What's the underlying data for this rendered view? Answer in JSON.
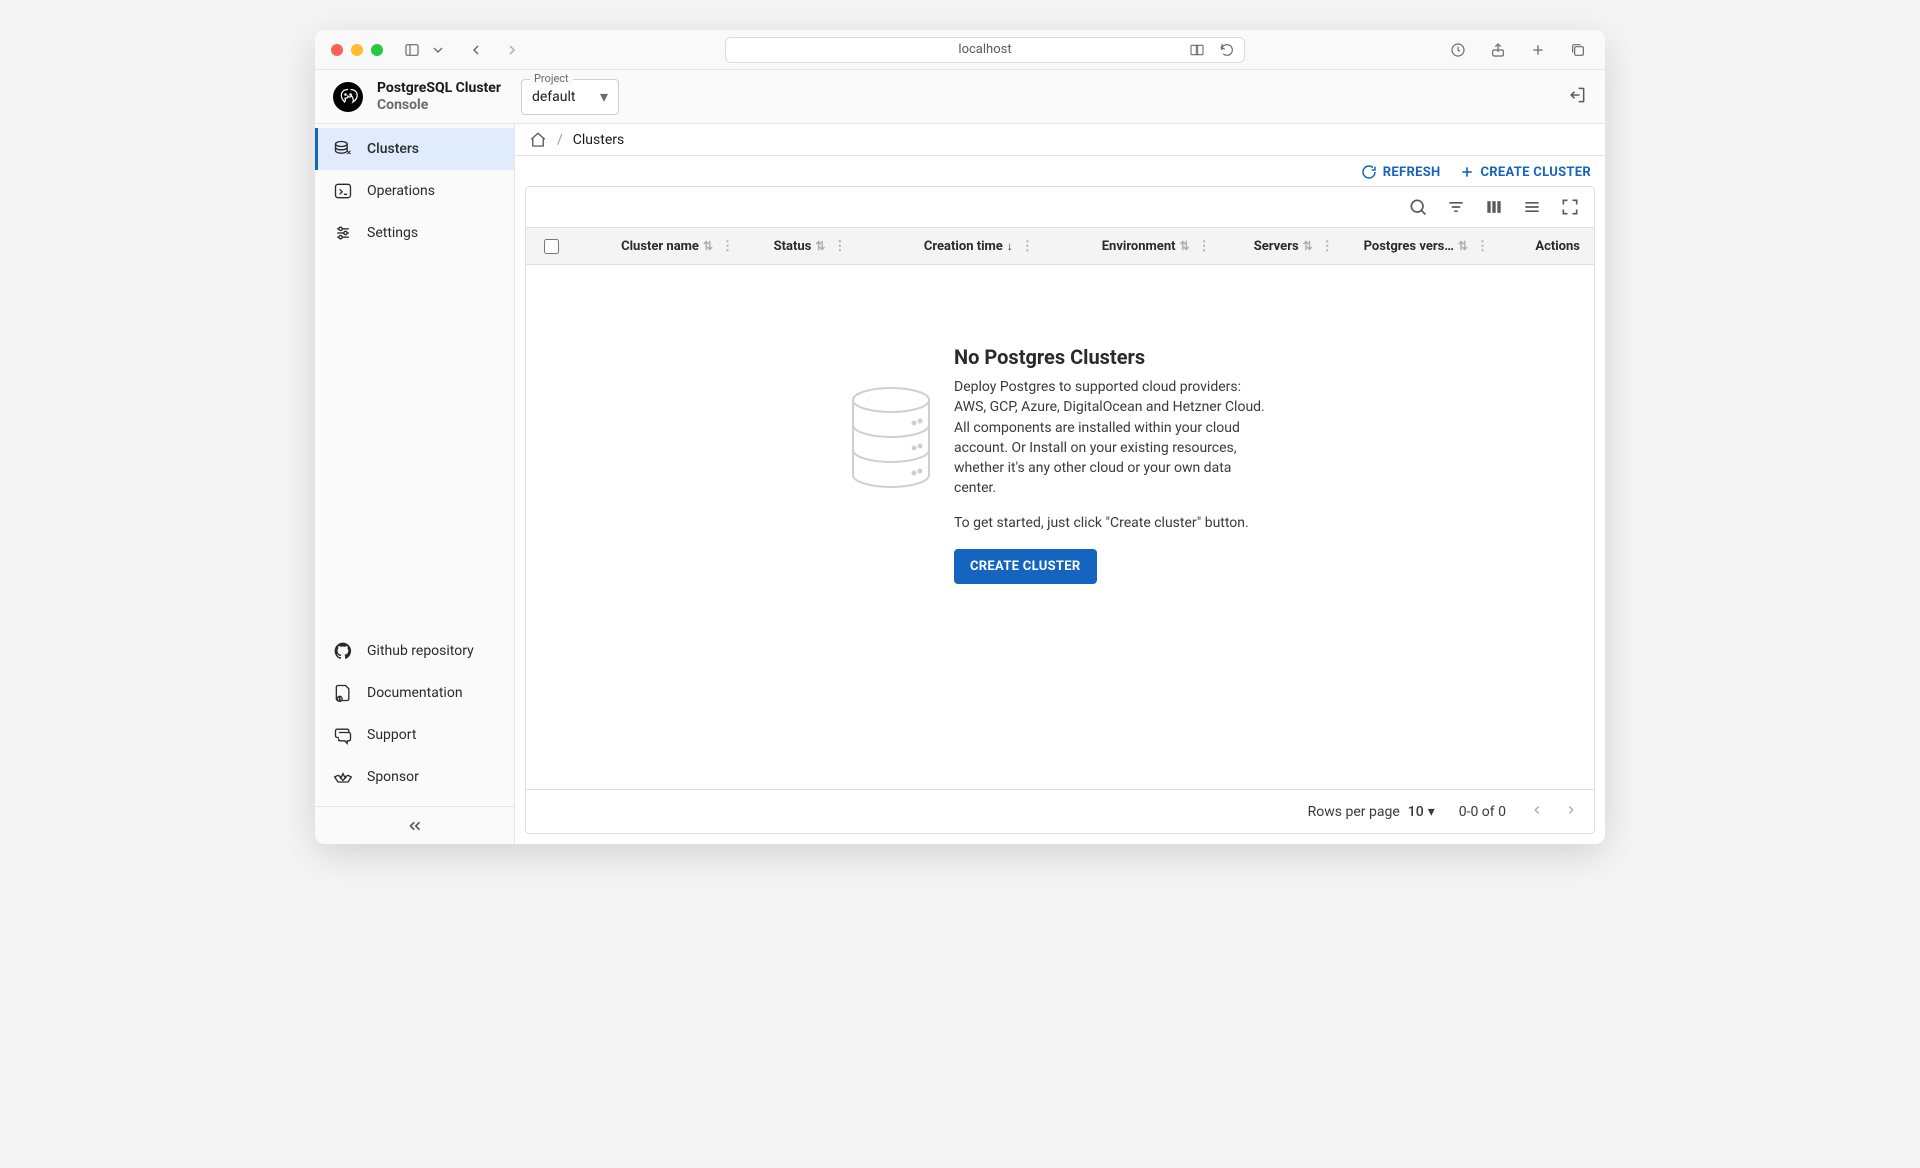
{
  "browser": {
    "address": "localhost"
  },
  "app": {
    "title_line1": "PostgreSQL Cluster",
    "title_line2": "Console",
    "project_label": "Project",
    "project_value": "default"
  },
  "sidebar": {
    "nav": [
      {
        "label": "Clusters"
      },
      {
        "label": "Operations"
      },
      {
        "label": "Settings"
      }
    ],
    "footer": [
      {
        "label": "Github repository"
      },
      {
        "label": "Documentation"
      },
      {
        "label": "Support"
      },
      {
        "label": "Sponsor"
      }
    ]
  },
  "breadcrumb": {
    "current": "Clusters",
    "separator": "/"
  },
  "actions": {
    "refresh": "REFRESH",
    "create_cluster": "CREATE CLUSTER"
  },
  "table": {
    "columns": {
      "cluster_name": "Cluster name",
      "status": "Status",
      "creation_time": "Creation time",
      "environment": "Environment",
      "servers": "Servers",
      "postgres_version": "Postgres vers…",
      "actions": "Actions"
    },
    "sorted_column": "creation_time",
    "sort_direction": "desc"
  },
  "empty": {
    "title": "No Postgres Clusters",
    "description": "Deploy Postgres to supported cloud providers: AWS, GCP, Azure, DigitalOcean and Hetzner Cloud. All components are installed within your cloud account. Or Install on your existing resources, whether it's any other cloud or your own data center.",
    "cta_text": "To get started, just click \"Create cluster\" button.",
    "button": "CREATE CLUSTER"
  },
  "pagination": {
    "rows_per_page_label": "Rows per page",
    "rows_per_page_value": "10",
    "range_text": "0-0 of 0"
  }
}
